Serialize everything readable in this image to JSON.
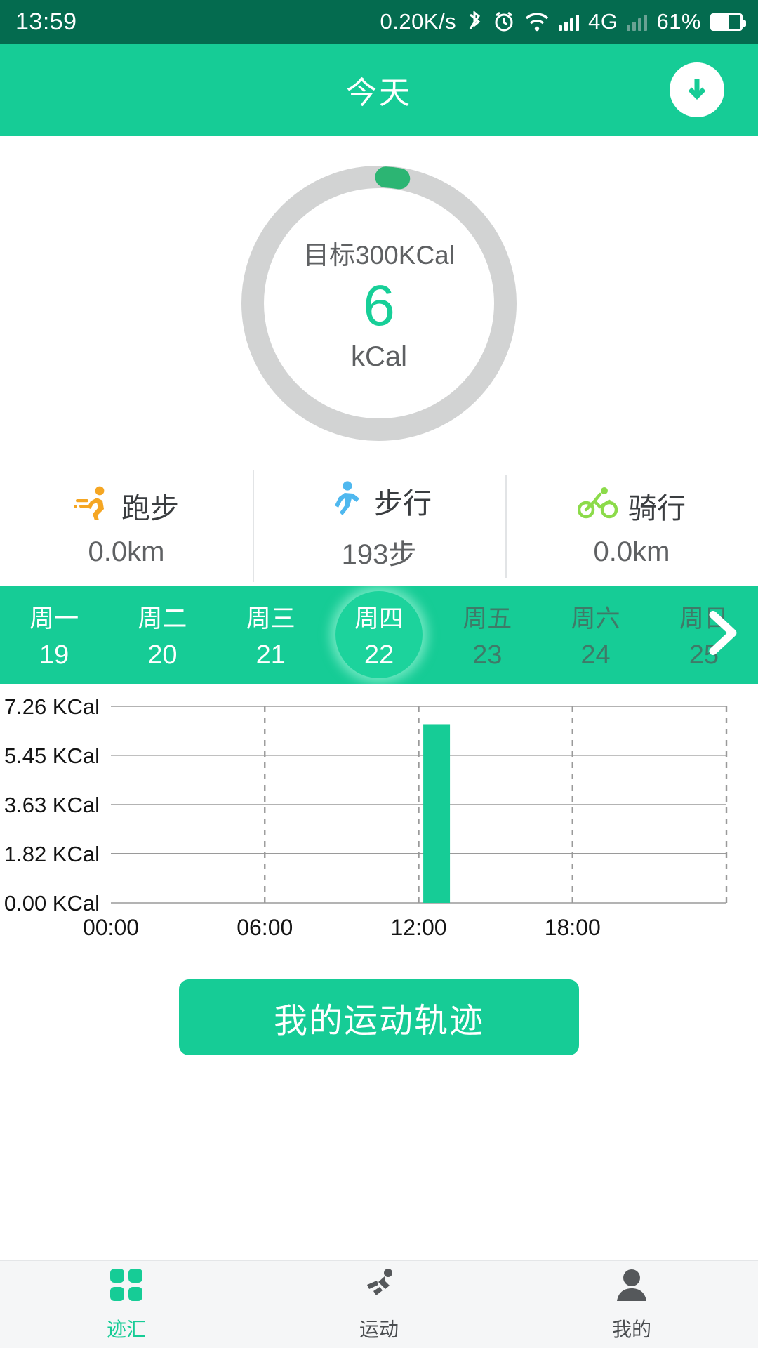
{
  "status_bar": {
    "time": "13:59",
    "net_speed": "0.20K/s",
    "battery_percent": "61%",
    "network_type": "4G",
    "icons": [
      "bluetooth-icon",
      "alarm-icon",
      "wifi-icon",
      "signal-icon",
      "signal-icon-2",
      "battery-icon"
    ]
  },
  "app_bar": {
    "title": "今天",
    "sync_icon": "download-circle-icon"
  },
  "ring": {
    "goal_label": "目标300KCal",
    "value": "6",
    "unit": "kCal",
    "goal_kcal": 300,
    "progress_percent": 2,
    "track_color": "#d2d3d3",
    "progress_color": "#2cb573"
  },
  "stats": [
    {
      "icon": "running-icon",
      "icon_color": "#f5a623",
      "label": "跑步",
      "value": "0.0km"
    },
    {
      "icon": "walking-icon",
      "icon_color": "#4fb8ef",
      "label": "步行",
      "value": "193步"
    },
    {
      "icon": "cycling-icon",
      "icon_color": "#8cdb4a",
      "label": "骑行",
      "value": "0.0km"
    }
  ],
  "week_selector": {
    "next_icon": "chevron-right-icon",
    "days": [
      {
        "dow": "周一",
        "num": "19",
        "state": "past"
      },
      {
        "dow": "周二",
        "num": "20",
        "state": "past"
      },
      {
        "dow": "周三",
        "num": "21",
        "state": "past"
      },
      {
        "dow": "周四",
        "num": "22",
        "state": "active"
      },
      {
        "dow": "周五",
        "num": "23",
        "state": "future"
      },
      {
        "dow": "周六",
        "num": "24",
        "state": "future"
      },
      {
        "dow": "周日",
        "num": "25",
        "state": "future"
      }
    ]
  },
  "chart_data": {
    "type": "bar",
    "title": "",
    "xlabel": "",
    "ylabel": "",
    "x_tick_labels": [
      "00:00",
      "06:00",
      "12:00",
      "18:00"
    ],
    "x_tick_values": [
      0,
      6,
      12,
      18
    ],
    "y_tick_labels": [
      "0.00 KCal",
      "1.82 KCal",
      "3.63 KCal",
      "5.45 KCal",
      "7.26 KCal"
    ],
    "y_tick_values": [
      0.0,
      1.82,
      3.63,
      5.45,
      7.26
    ],
    "ylim": [
      0,
      7.26
    ],
    "xlim": [
      0,
      24
    ],
    "grid": true,
    "legend": "none",
    "bar_color": "#16cc96",
    "bars": [
      {
        "x": 12.7,
        "value": 6.6,
        "label": "12:42"
      }
    ]
  },
  "cta": {
    "label": "我的运动轨迹"
  },
  "bottom_nav": {
    "items": [
      {
        "icon": "grid-icon",
        "label": "迹汇",
        "active": true
      },
      {
        "icon": "exercise-icon",
        "label": "运动",
        "active": false
      },
      {
        "icon": "person-icon",
        "label": "我的",
        "active": false
      }
    ]
  },
  "colors": {
    "brand": "#16cc96",
    "status_bar": "#046b4f",
    "accent_text": "#17cf98"
  }
}
